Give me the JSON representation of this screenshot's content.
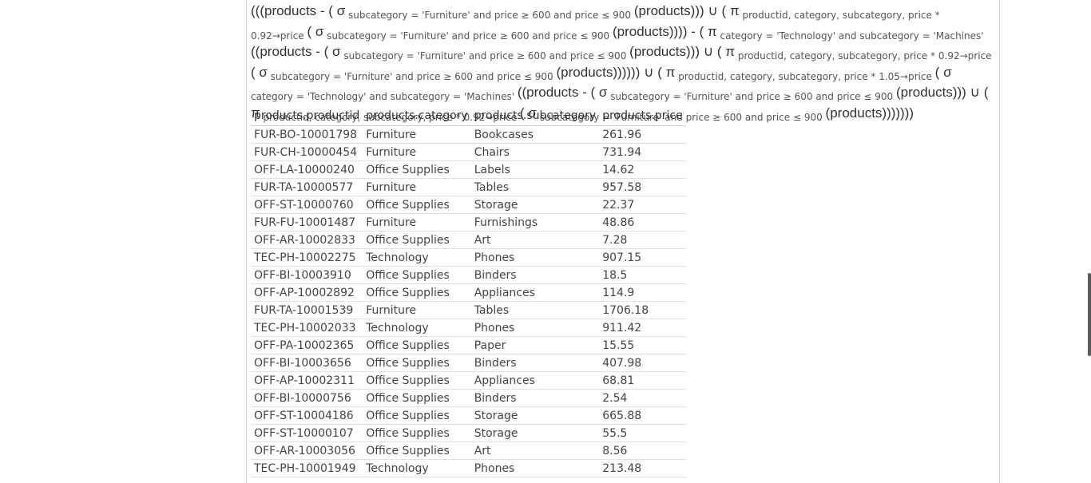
{
  "expression": {
    "segments": [
      {
        "t": "(((",
        "c": "big"
      },
      {
        "t": "products",
        "c": "big"
      },
      {
        "t": " - ( ",
        "c": "big"
      },
      {
        "t": "σ",
        "c": "big"
      },
      {
        "t": " subcategory = 'Furniture' and price ≥ 600 and price ≤ 900 ",
        "c": "sub"
      },
      {
        "t": "(products)",
        "c": "big"
      },
      {
        "t": ")) ∪ ( ",
        "c": "big"
      },
      {
        "t": "π",
        "c": "big"
      },
      {
        "t": " productid, category, subcategory, price * 0.92→price ",
        "c": "sub"
      },
      {
        "t": "( ",
        "c": "big"
      },
      {
        "t": "σ",
        "c": "big"
      },
      {
        "t": " subcategory = 'Furniture' and price ≥ 600 and price ≤ 900 ",
        "c": "sub"
      },
      {
        "t": "(products)",
        "c": "big"
      },
      {
        "t": "))) - ( ",
        "c": "big"
      },
      {
        "t": "π",
        "c": "big"
      },
      {
        "t": " category = 'Technology' and subcategory = 'Machines' ",
        "c": "sub"
      },
      {
        "t": "((products - ( ",
        "c": "big"
      },
      {
        "t": "σ",
        "c": "big"
      },
      {
        "t": " subcategory = 'Furniture' and price ≥ 600 and price ≤ 900 ",
        "c": "sub"
      },
      {
        "t": "(products)",
        "c": "big"
      },
      {
        "t": ")) ∪ ( ",
        "c": "big"
      },
      {
        "t": "π",
        "c": "big"
      },
      {
        "t": " productid, category, subcategory, price * 0.92→price ",
        "c": "sub"
      },
      {
        "t": "( ",
        "c": "big"
      },
      {
        "t": "σ",
        "c": "big"
      },
      {
        "t": " subcategory = 'Furniture' and price ≥ 600 and price ≤ 900 ",
        "c": "sub"
      },
      {
        "t": "(products)",
        "c": "big"
      },
      {
        "t": "))))) ∪ ( ",
        "c": "big"
      },
      {
        "t": "π",
        "c": "big"
      },
      {
        "t": " productid, category, subcategory, price * 1.05→price ",
        "c": "sub"
      },
      {
        "t": "( ",
        "c": "big"
      },
      {
        "t": "σ",
        "c": "big"
      },
      {
        "t": " category = 'Technology' and subcategory = 'Machines' ",
        "c": "sub"
      },
      {
        "t": "((products - ( ",
        "c": "big"
      },
      {
        "t": "σ",
        "c": "big"
      },
      {
        "t": " subcategory = 'Furniture' and price ≥ 600 and price ≤ 900 ",
        "c": "sub"
      },
      {
        "t": "(products)",
        "c": "big"
      },
      {
        "t": ")) ∪ ( ",
        "c": "big"
      },
      {
        "t": "π",
        "c": "big"
      },
      {
        "t": " productid, category, subcategory, price * 0.92→price ",
        "c": "sub"
      },
      {
        "t": "( ",
        "c": "big"
      },
      {
        "t": "σ",
        "c": "big"
      },
      {
        "t": " subcategory = 'Furniture' and price ≥ 600 and price ≤ 900 ",
        "c": "sub"
      },
      {
        "t": "(products)",
        "c": "big"
      },
      {
        "t": "))))))",
        "c": "big"
      }
    ]
  },
  "table": {
    "columns": [
      "products.productid",
      "products.category",
      "products.subcategory",
      "products.price"
    ],
    "rows": [
      [
        "FUR-BO-10001798",
        "Furniture",
        "Bookcases",
        "261.96"
      ],
      [
        "FUR-CH-10000454",
        "Furniture",
        "Chairs",
        "731.94"
      ],
      [
        "OFF-LA-10000240",
        "Office Supplies",
        "Labels",
        "14.62"
      ],
      [
        "FUR-TA-10000577",
        "Furniture",
        "Tables",
        "957.58"
      ],
      [
        "OFF-ST-10000760",
        "Office Supplies",
        "Storage",
        "22.37"
      ],
      [
        "FUR-FU-10001487",
        "Furniture",
        "Furnishings",
        "48.86"
      ],
      [
        "OFF-AR-10002833",
        "Office Supplies",
        "Art",
        "7.28"
      ],
      [
        "TEC-PH-10002275",
        "Technology",
        "Phones",
        "907.15"
      ],
      [
        "OFF-BI-10003910",
        "Office Supplies",
        "Binders",
        "18.5"
      ],
      [
        "OFF-AP-10002892",
        "Office Supplies",
        "Appliances",
        "114.9"
      ],
      [
        "FUR-TA-10001539",
        "Furniture",
        "Tables",
        "1706.18"
      ],
      [
        "TEC-PH-10002033",
        "Technology",
        "Phones",
        "911.42"
      ],
      [
        "OFF-PA-10002365",
        "Office Supplies",
        "Paper",
        "15.55"
      ],
      [
        "OFF-BI-10003656",
        "Office Supplies",
        "Binders",
        "407.98"
      ],
      [
        "OFF-AP-10002311",
        "Office Supplies",
        "Appliances",
        "68.81"
      ],
      [
        "OFF-BI-10000756",
        "Office Supplies",
        "Binders",
        "2.54"
      ],
      [
        "OFF-ST-10004186",
        "Office Supplies",
        "Storage",
        "665.88"
      ],
      [
        "OFF-ST-10000107",
        "Office Supplies",
        "Storage",
        "55.5"
      ],
      [
        "OFF-AR-10003056",
        "Office Supplies",
        "Art",
        "8.56"
      ],
      [
        "TEC-PH-10001949",
        "Technology",
        "Phones",
        "213.48"
      ]
    ]
  }
}
